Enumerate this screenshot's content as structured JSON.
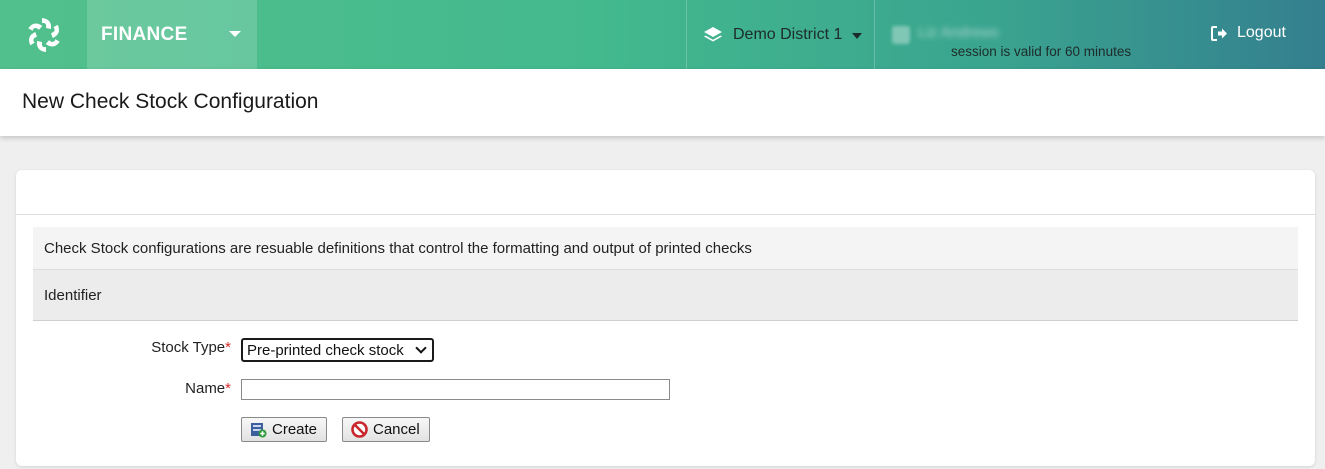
{
  "nav": {
    "module": "FINANCE",
    "district": "Demo District 1",
    "user_name": "Liz Andrews",
    "session": "session is valid for 60 minutes",
    "logout": "Logout"
  },
  "page": {
    "title": "New Check Stock Configuration"
  },
  "form": {
    "description": "Check Stock configurations are resuable definitions that control the formatting and output of printed checks",
    "section": "Identifier",
    "stock_type_label": "Stock Type",
    "stock_type_value": "Pre-printed check stock",
    "name_label": "Name",
    "name_value": "",
    "required_marker": "*",
    "create_label": "Create",
    "cancel_label": "Cancel"
  },
  "colors": {
    "nav_start": "#52c08c",
    "nav_end": "#347f8f",
    "required": "#d62b2b"
  }
}
